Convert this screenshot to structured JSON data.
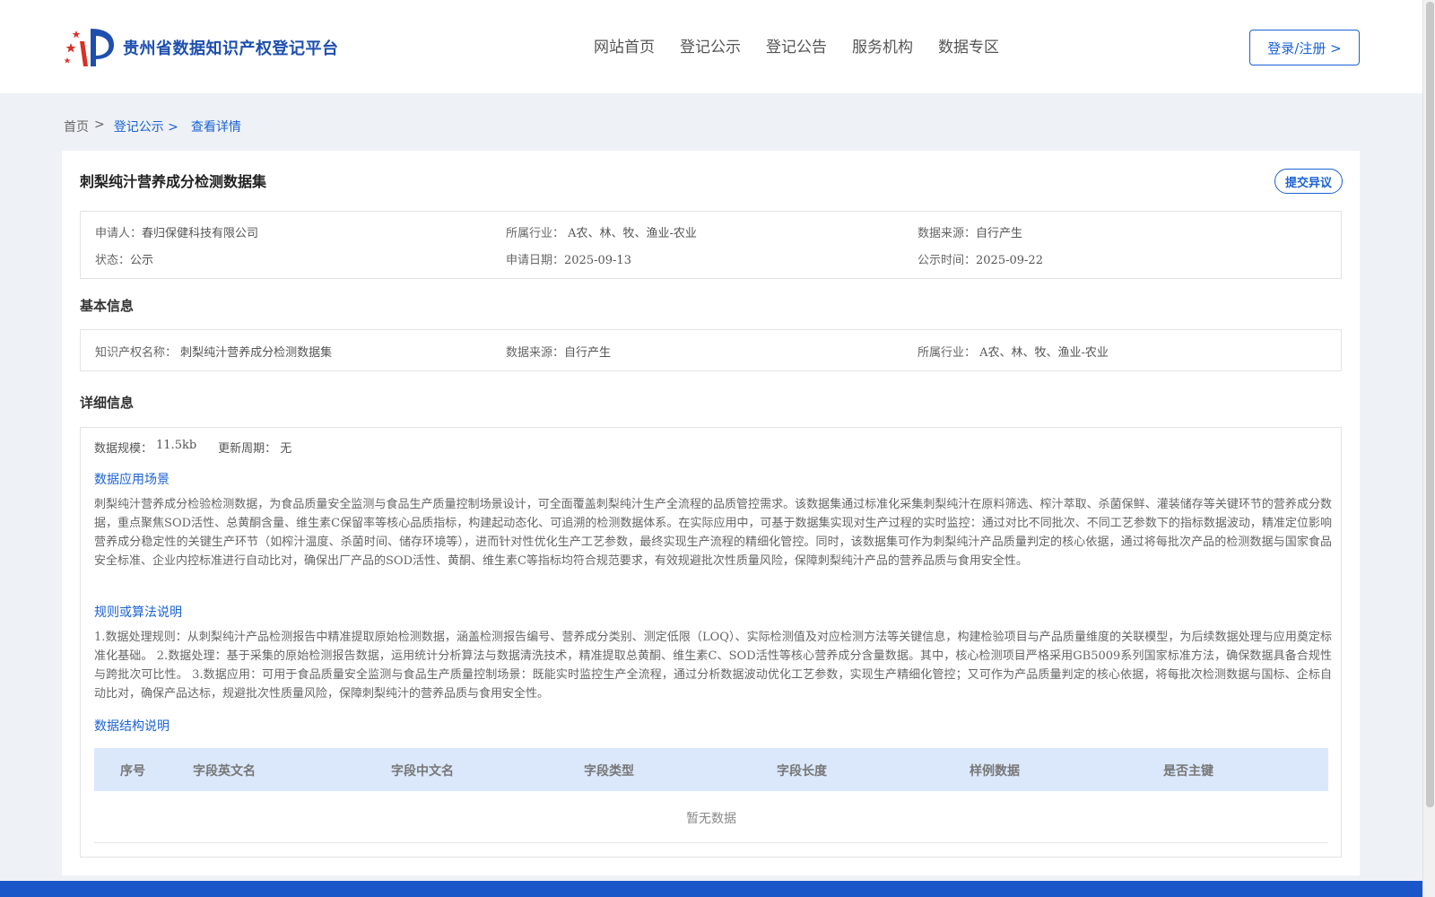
{
  "header": {
    "brand": "贵州省数据知识产权登记平台",
    "nav": [
      "网站首页",
      "登记公示",
      "登记公告",
      "服务机构",
      "数据专区"
    ],
    "login_label": "登录/注册 >"
  },
  "breadcrumb": {
    "home": "首页",
    "sep": ">",
    "section": "登记公示 >",
    "current": "查看详情"
  },
  "record": {
    "title": "刺梨纯汁营养成分检测数据集",
    "objection_label": "提交异议",
    "applicant_label": "申请人：",
    "applicant": "春归保健科技有限公司",
    "industry_label": "所属行业：",
    "industry": "A农、林、牧、渔业-农业",
    "source_label": "数据来源：",
    "source": "自行产生",
    "status_label": "状态：",
    "status": "公示",
    "apply_date_label": "申请日期：",
    "apply_date": "2025-09-13",
    "publish_date_label": "公示时间：",
    "publish_date": "2025-09-22"
  },
  "basic": {
    "title": "基本信息",
    "ip_name_label": "知识产权名称：",
    "ip_name": "刺梨纯汁营养成分检测数据集",
    "source_label": "数据来源：",
    "source": "自行产生",
    "industry_label": "所属行业：",
    "industry": "A农、林、牧、渔业-农业"
  },
  "detail": {
    "title": "详细信息",
    "scale_label": "数据规模：",
    "scale": "11.5kb",
    "cycle_label": "更新周期：",
    "cycle": "无",
    "scenario_title": "数据应用场景",
    "scenario_text": "刺梨纯汁营养成分检验检测数据，为食品质量安全监测与食品生产质量控制场景设计，可全面覆盖刺梨纯汁生产全流程的品质管控需求。该数据集通过标准化采集刺梨纯汁在原料筛选、榨汁萃取、杀菌保鲜、灌装储存等关键环节的营养成分数据，重点聚焦SOD活性、总黄酮含量、维生素C保留率等核心品质指标，构建起动态化、可追溯的检测数据体系。在实际应用中，可基于数据集实现对生产过程的实时监控：通过对比不同批次、不同工艺参数下的指标数据波动，精准定位影响营养成分稳定性的关键生产环节（如榨汁温度、杀菌时间、储存环境等），进而针对性优化生产工艺参数，最终实现生产流程的精细化管控。同时，该数据集可作为刺梨纯汁产品质量判定的核心依据，通过将每批次产品的检测数据与国家食品安全标准、企业内控标准进行自动比对，确保出厂产品的SOD活性、黄酮、维生素C等指标均符合规范要求，有效规避批次性质量风险，保障刺梨纯汁产品的营养品质与食用安全性。",
    "rules_title": "规则或算法说明",
    "rules_text": "1.数据处理规则：从刺梨纯汁产品检测报告中精准提取原始检测数据，涵盖检测报告编号、营养成分类别、测定低限（LOQ）、实际检测值及对应检测方法等关键信息，构建检验项目与产品质量维度的关联模型，为后续数据处理与应用奠定标准化基础。 2.数据处理：基于采集的原始检测报告数据，运用统计分析算法与数据清洗技术，精准提取总黄酮、维生素C、SOD活性等核心营养成分含量数据。其中，核心检测项目严格采用GB5009系列国家标准方法，确保数据具备合规性与跨批次可比性。 3.数据应用：可用于食品质量安全监测与食品生产质量控制场景：既能实时监控生产全流程，通过分析数据波动优化工艺参数，实现生产精细化管控；又可作为产品质量判定的核心依据，将每批次检测数据与国标、企标自动比对，确保产品达标，规避批次性质量风险，保障刺梨纯汁的营养品质与食用安全性。",
    "structure_title": "数据结构说明",
    "table_headers": [
      "序号",
      "字段英文名",
      "字段中文名",
      "字段类型",
      "字段长度",
      "样例数据",
      "是否主键"
    ],
    "empty_text": "暂无数据"
  },
  "colors": {
    "accent": "#1a62d4",
    "table_header_bg": "#dbe8fb",
    "footer": "#1a56c8"
  }
}
